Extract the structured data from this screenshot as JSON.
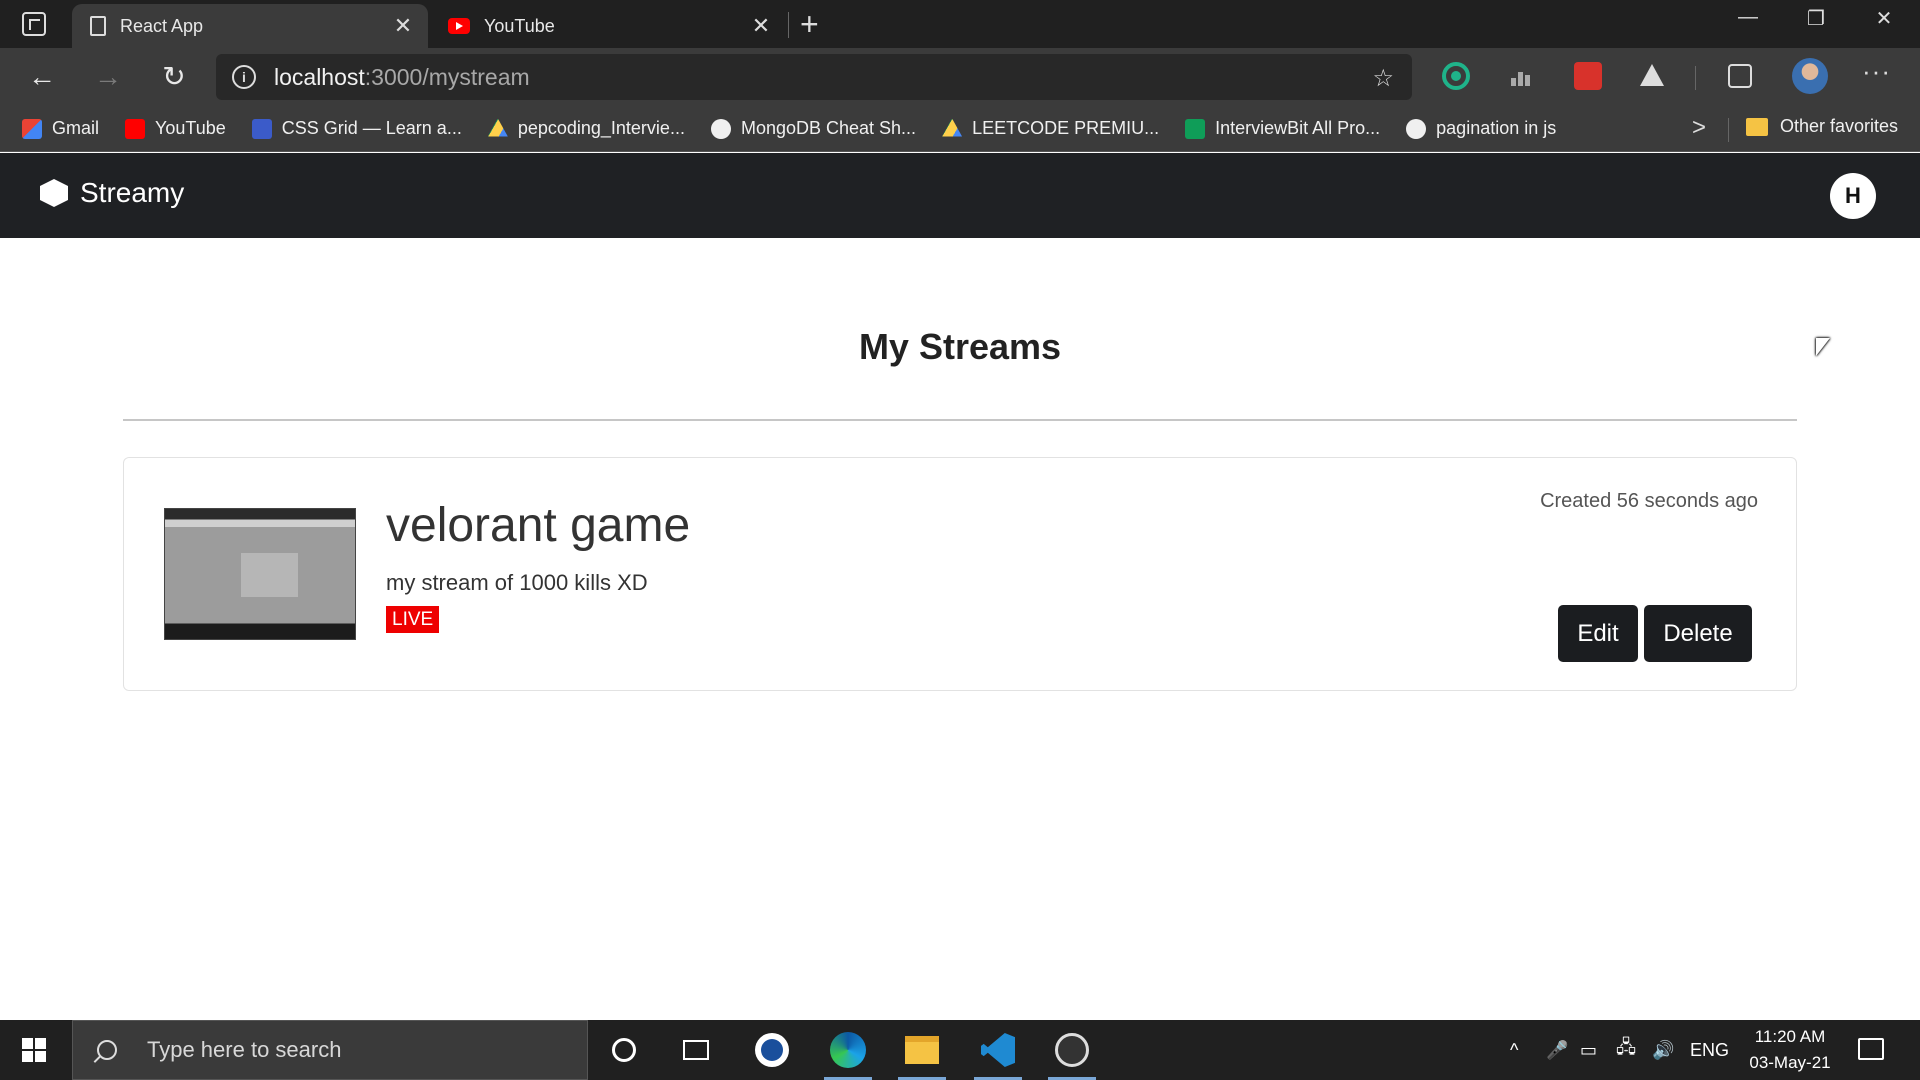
{
  "browser": {
    "tabs": [
      {
        "title": "React App",
        "close": "✕"
      },
      {
        "title": "YouTube",
        "close": "✕"
      }
    ],
    "new_tab": "+",
    "window_controls": {
      "minimize": "—",
      "restore": "❐",
      "close": "✕"
    },
    "nav": {
      "back": "←",
      "forward": "→",
      "reload": "↻"
    },
    "address": {
      "host": "localhost",
      "path": ":3000/mystream"
    },
    "more": "···",
    "bookmarks": [
      {
        "label": "Gmail",
        "icon": "gmail-icon"
      },
      {
        "label": "YouTube",
        "icon": "youtube-icon"
      },
      {
        "label": "CSS Grid — Learn a...",
        "icon": "css-grid-icon"
      },
      {
        "label": "pepcoding_Intervie...",
        "icon": "drive-icon"
      },
      {
        "label": "MongoDB Cheat Sh...",
        "icon": "github-icon"
      },
      {
        "label": "LEETCODE PREMIU...",
        "icon": "drive-icon"
      },
      {
        "label": "InterviewBit All Pro...",
        "icon": "sheets-icon"
      },
      {
        "label": "pagination in js",
        "icon": "github-icon"
      }
    ],
    "bookmarks_more": ">",
    "other_favorites": "Other favorites"
  },
  "app": {
    "brand": "Streamy",
    "user_initial": "H",
    "page_title": "My Streams",
    "streams": [
      {
        "title": "velorant game",
        "description": "my stream of 1000 kills XD",
        "status": "LIVE",
        "created": "Created 56 seconds ago",
        "edit_label": "Edit",
        "delete_label": "Delete"
      }
    ]
  },
  "taskbar": {
    "search_placeholder": "Type here to search",
    "tray": {
      "chevron": "^",
      "language": "ENG"
    },
    "clock": {
      "time": "11:20 AM",
      "date": "03-May-21"
    }
  },
  "colors": {
    "nav_bg": "#1f2124",
    "live_badge": "#ee0000",
    "button_bg": "#1b1d20"
  }
}
